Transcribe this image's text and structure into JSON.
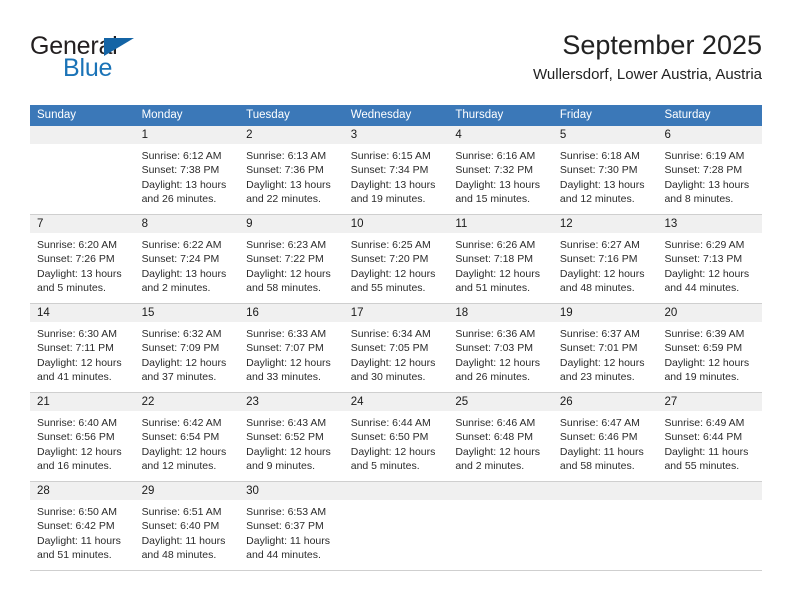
{
  "logo": {
    "word_one": "General",
    "word_two": "Blue",
    "triangle_icon": "blue-triangle-icon",
    "color_dark": "#231f20",
    "color_blue": "#1a73b7"
  },
  "header": {
    "title": "September 2025",
    "subtitle": "Wullersdorf, Lower Austria, Austria"
  },
  "theme": {
    "header_bg": "#3b78b8",
    "header_text": "#ffffff",
    "day_strip_bg": "#f0f0f0",
    "grid_line": "#cfcfcf"
  },
  "calendar": {
    "weekdays": [
      "Sunday",
      "Monday",
      "Tuesday",
      "Wednesday",
      "Thursday",
      "Friday",
      "Saturday"
    ],
    "weeks": [
      [
        {
          "day": "",
          "lines": []
        },
        {
          "day": "1",
          "lines": [
            "Sunrise: 6:12 AM",
            "Sunset: 7:38 PM",
            "Daylight: 13 hours",
            "and 26 minutes."
          ]
        },
        {
          "day": "2",
          "lines": [
            "Sunrise: 6:13 AM",
            "Sunset: 7:36 PM",
            "Daylight: 13 hours",
            "and 22 minutes."
          ]
        },
        {
          "day": "3",
          "lines": [
            "Sunrise: 6:15 AM",
            "Sunset: 7:34 PM",
            "Daylight: 13 hours",
            "and 19 minutes."
          ]
        },
        {
          "day": "4",
          "lines": [
            "Sunrise: 6:16 AM",
            "Sunset: 7:32 PM",
            "Daylight: 13 hours",
            "and 15 minutes."
          ]
        },
        {
          "day": "5",
          "lines": [
            "Sunrise: 6:18 AM",
            "Sunset: 7:30 PM",
            "Daylight: 13 hours",
            "and 12 minutes."
          ]
        },
        {
          "day": "6",
          "lines": [
            "Sunrise: 6:19 AM",
            "Sunset: 7:28 PM",
            "Daylight: 13 hours",
            "and 8 minutes."
          ]
        }
      ],
      [
        {
          "day": "7",
          "lines": [
            "Sunrise: 6:20 AM",
            "Sunset: 7:26 PM",
            "Daylight: 13 hours",
            "and 5 minutes."
          ]
        },
        {
          "day": "8",
          "lines": [
            "Sunrise: 6:22 AM",
            "Sunset: 7:24 PM",
            "Daylight: 13 hours",
            "and 2 minutes."
          ]
        },
        {
          "day": "9",
          "lines": [
            "Sunrise: 6:23 AM",
            "Sunset: 7:22 PM",
            "Daylight: 12 hours",
            "and 58 minutes."
          ]
        },
        {
          "day": "10",
          "lines": [
            "Sunrise: 6:25 AM",
            "Sunset: 7:20 PM",
            "Daylight: 12 hours",
            "and 55 minutes."
          ]
        },
        {
          "day": "11",
          "lines": [
            "Sunrise: 6:26 AM",
            "Sunset: 7:18 PM",
            "Daylight: 12 hours",
            "and 51 minutes."
          ]
        },
        {
          "day": "12",
          "lines": [
            "Sunrise: 6:27 AM",
            "Sunset: 7:16 PM",
            "Daylight: 12 hours",
            "and 48 minutes."
          ]
        },
        {
          "day": "13",
          "lines": [
            "Sunrise: 6:29 AM",
            "Sunset: 7:13 PM",
            "Daylight: 12 hours",
            "and 44 minutes."
          ]
        }
      ],
      [
        {
          "day": "14",
          "lines": [
            "Sunrise: 6:30 AM",
            "Sunset: 7:11 PM",
            "Daylight: 12 hours",
            "and 41 minutes."
          ]
        },
        {
          "day": "15",
          "lines": [
            "Sunrise: 6:32 AM",
            "Sunset: 7:09 PM",
            "Daylight: 12 hours",
            "and 37 minutes."
          ]
        },
        {
          "day": "16",
          "lines": [
            "Sunrise: 6:33 AM",
            "Sunset: 7:07 PM",
            "Daylight: 12 hours",
            "and 33 minutes."
          ]
        },
        {
          "day": "17",
          "lines": [
            "Sunrise: 6:34 AM",
            "Sunset: 7:05 PM",
            "Daylight: 12 hours",
            "and 30 minutes."
          ]
        },
        {
          "day": "18",
          "lines": [
            "Sunrise: 6:36 AM",
            "Sunset: 7:03 PM",
            "Daylight: 12 hours",
            "and 26 minutes."
          ]
        },
        {
          "day": "19",
          "lines": [
            "Sunrise: 6:37 AM",
            "Sunset: 7:01 PM",
            "Daylight: 12 hours",
            "and 23 minutes."
          ]
        },
        {
          "day": "20",
          "lines": [
            "Sunrise: 6:39 AM",
            "Sunset: 6:59 PM",
            "Daylight: 12 hours",
            "and 19 minutes."
          ]
        }
      ],
      [
        {
          "day": "21",
          "lines": [
            "Sunrise: 6:40 AM",
            "Sunset: 6:56 PM",
            "Daylight: 12 hours",
            "and 16 minutes."
          ]
        },
        {
          "day": "22",
          "lines": [
            "Sunrise: 6:42 AM",
            "Sunset: 6:54 PM",
            "Daylight: 12 hours",
            "and 12 minutes."
          ]
        },
        {
          "day": "23",
          "lines": [
            "Sunrise: 6:43 AM",
            "Sunset: 6:52 PM",
            "Daylight: 12 hours",
            "and 9 minutes."
          ]
        },
        {
          "day": "24",
          "lines": [
            "Sunrise: 6:44 AM",
            "Sunset: 6:50 PM",
            "Daylight: 12 hours",
            "and 5 minutes."
          ]
        },
        {
          "day": "25",
          "lines": [
            "Sunrise: 6:46 AM",
            "Sunset: 6:48 PM",
            "Daylight: 12 hours",
            "and 2 minutes."
          ]
        },
        {
          "day": "26",
          "lines": [
            "Sunrise: 6:47 AM",
            "Sunset: 6:46 PM",
            "Daylight: 11 hours",
            "and 58 minutes."
          ]
        },
        {
          "day": "27",
          "lines": [
            "Sunrise: 6:49 AM",
            "Sunset: 6:44 PM",
            "Daylight: 11 hours",
            "and 55 minutes."
          ]
        }
      ],
      [
        {
          "day": "28",
          "lines": [
            "Sunrise: 6:50 AM",
            "Sunset: 6:42 PM",
            "Daylight: 11 hours",
            "and 51 minutes."
          ]
        },
        {
          "day": "29",
          "lines": [
            "Sunrise: 6:51 AM",
            "Sunset: 6:40 PM",
            "Daylight: 11 hours",
            "and 48 minutes."
          ]
        },
        {
          "day": "30",
          "lines": [
            "Sunrise: 6:53 AM",
            "Sunset: 6:37 PM",
            "Daylight: 11 hours",
            "and 44 minutes."
          ]
        },
        {
          "day": "",
          "lines": []
        },
        {
          "day": "",
          "lines": []
        },
        {
          "day": "",
          "lines": []
        },
        {
          "day": "",
          "lines": []
        }
      ]
    ]
  }
}
